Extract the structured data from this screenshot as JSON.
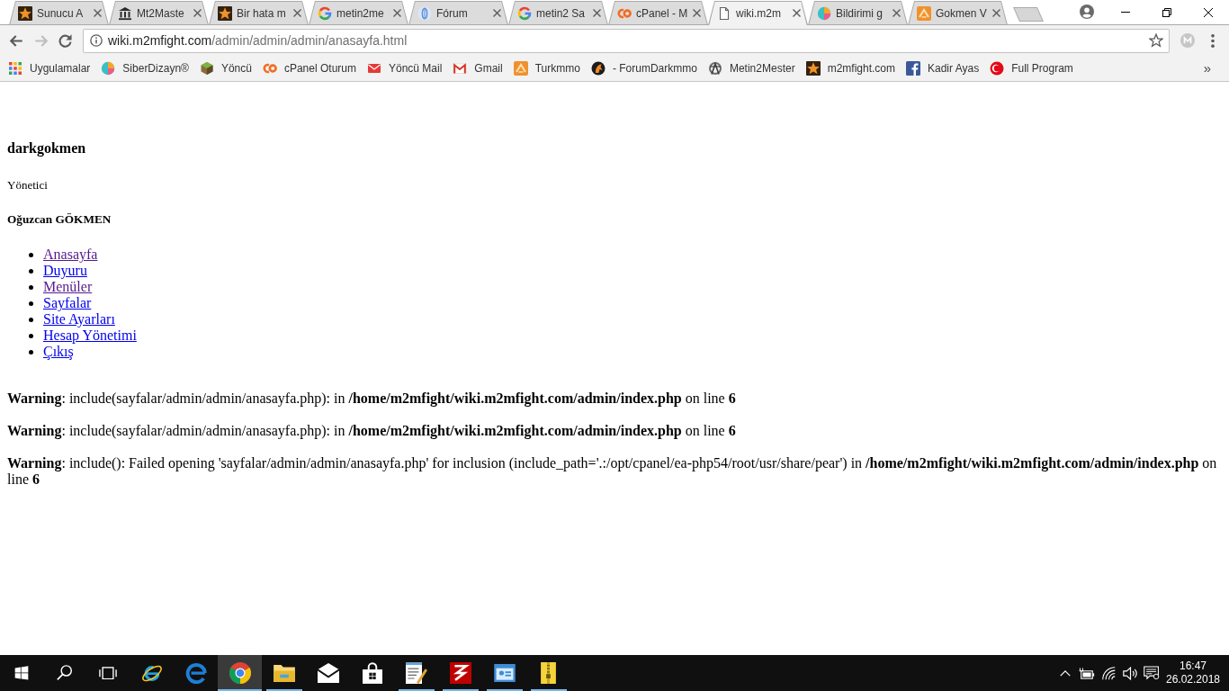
{
  "browser": {
    "tabs": [
      {
        "title": "Sunucu A",
        "kind": "star",
        "selected": false
      },
      {
        "title": "Mt2Maste",
        "kind": "columns",
        "selected": false
      },
      {
        "title": "Bir hata m",
        "kind": "star",
        "selected": false
      },
      {
        "title": "metin2me",
        "kind": "google",
        "selected": false
      },
      {
        "title": "Fórum",
        "kind": "oval",
        "selected": false
      },
      {
        "title": "metin2 Sa",
        "kind": "google",
        "selected": false
      },
      {
        "title": "cPanel - M",
        "kind": "cpanel",
        "selected": false
      },
      {
        "title": "wiki.m2m",
        "kind": "document",
        "selected": true
      },
      {
        "title": "Bildirimi g",
        "kind": "pie",
        "selected": false
      },
      {
        "title": "Gokmen V",
        "kind": "tile",
        "selected": false
      }
    ],
    "toolbar": {
      "nav": [
        {
          "kind": "back",
          "disabled": false
        },
        {
          "kind": "forward",
          "disabled": true
        },
        {
          "kind": "reload",
          "disabled": false
        }
      ],
      "address": {
        "host": "wiki.m2mfight.com",
        "path": "/admin/admin/admin/anasayfa.html"
      }
    },
    "bookmarks": {
      "items": [
        {
          "label": "Uygulamalar",
          "kind": "apps"
        },
        {
          "label": "SiberDizayn®",
          "kind": "pie"
        },
        {
          "label": "Yöncü",
          "kind": "cube"
        },
        {
          "label": "cPanel Oturum",
          "kind": "cpanel"
        },
        {
          "label": "Yöncü Mail",
          "kind": "envelope"
        },
        {
          "label": "Gmail",
          "kind": "gmail"
        },
        {
          "label": "Turkmmo",
          "kind": "tile"
        },
        {
          "label": "- ForumDarkmmo",
          "kind": "horse"
        },
        {
          "label": "Metin2Mester",
          "kind": "emblem"
        },
        {
          "label": "m2mfight.com",
          "kind": "star"
        },
        {
          "label": "Kadir Ayas",
          "kind": "facebook"
        },
        {
          "label": "Full Program",
          "kind": "crescent"
        }
      ],
      "more": "»"
    }
  },
  "page": {
    "username": "darkgokmen",
    "role": "Yönetici",
    "full_name": "Oğuzcan GÖKMEN",
    "menu": [
      {
        "label": "Anasayfa",
        "visited": true
      },
      {
        "label": "Duyuru",
        "visited": false
      },
      {
        "label": "Menüler",
        "visited": true
      },
      {
        "label": "Sayfalar",
        "visited": false
      },
      {
        "label": "Site Ayarları",
        "visited": false
      },
      {
        "label": "Hesap Yönetimi",
        "visited": false
      },
      {
        "label": "Çıkış",
        "visited": false
      }
    ],
    "warnings": [
      "**Warning**: include(sayfalar/admin/admin/anasayfa.php): in **/home/m2mfight/wiki.m2mfight.com/admin/index.php** on line **6**",
      "**Warning**: include(sayfalar/admin/admin/anasayfa.php): in **/home/m2mfight/wiki.m2mfight.com/admin/index.php** on line **6**",
      "**Warning**: include(): Failed opening 'sayfalar/admin/admin/anasayfa.php' for inclusion (include_path='.:/opt/cpanel/ea-php54/root/usr/share/pear') in **/home/m2mfight/wiki.m2mfight.com/admin/index.php** on line **6**"
    ]
  },
  "taskbar": {
    "apps": [
      {
        "kind": "start",
        "running": false,
        "active": false
      },
      {
        "kind": "search",
        "running": false,
        "active": false
      },
      {
        "kind": "taskview",
        "running": false,
        "active": false
      },
      {
        "kind": "ie",
        "running": false,
        "active": false
      },
      {
        "kind": "edge",
        "running": false,
        "active": false
      },
      {
        "kind": "chrome",
        "running": true,
        "active": true
      },
      {
        "kind": "explorer",
        "running": true,
        "active": false
      },
      {
        "kind": "mail",
        "running": false,
        "active": false
      },
      {
        "kind": "store",
        "running": false,
        "active": false
      },
      {
        "kind": "notepad",
        "running": true,
        "active": false
      },
      {
        "kind": "filezilla",
        "running": true,
        "active": false
      },
      {
        "kind": "app",
        "running": true,
        "active": false
      },
      {
        "kind": "archive",
        "running": true,
        "active": false
      }
    ],
    "clock": {
      "time": "16:47",
      "date": "26.02.2018"
    }
  }
}
